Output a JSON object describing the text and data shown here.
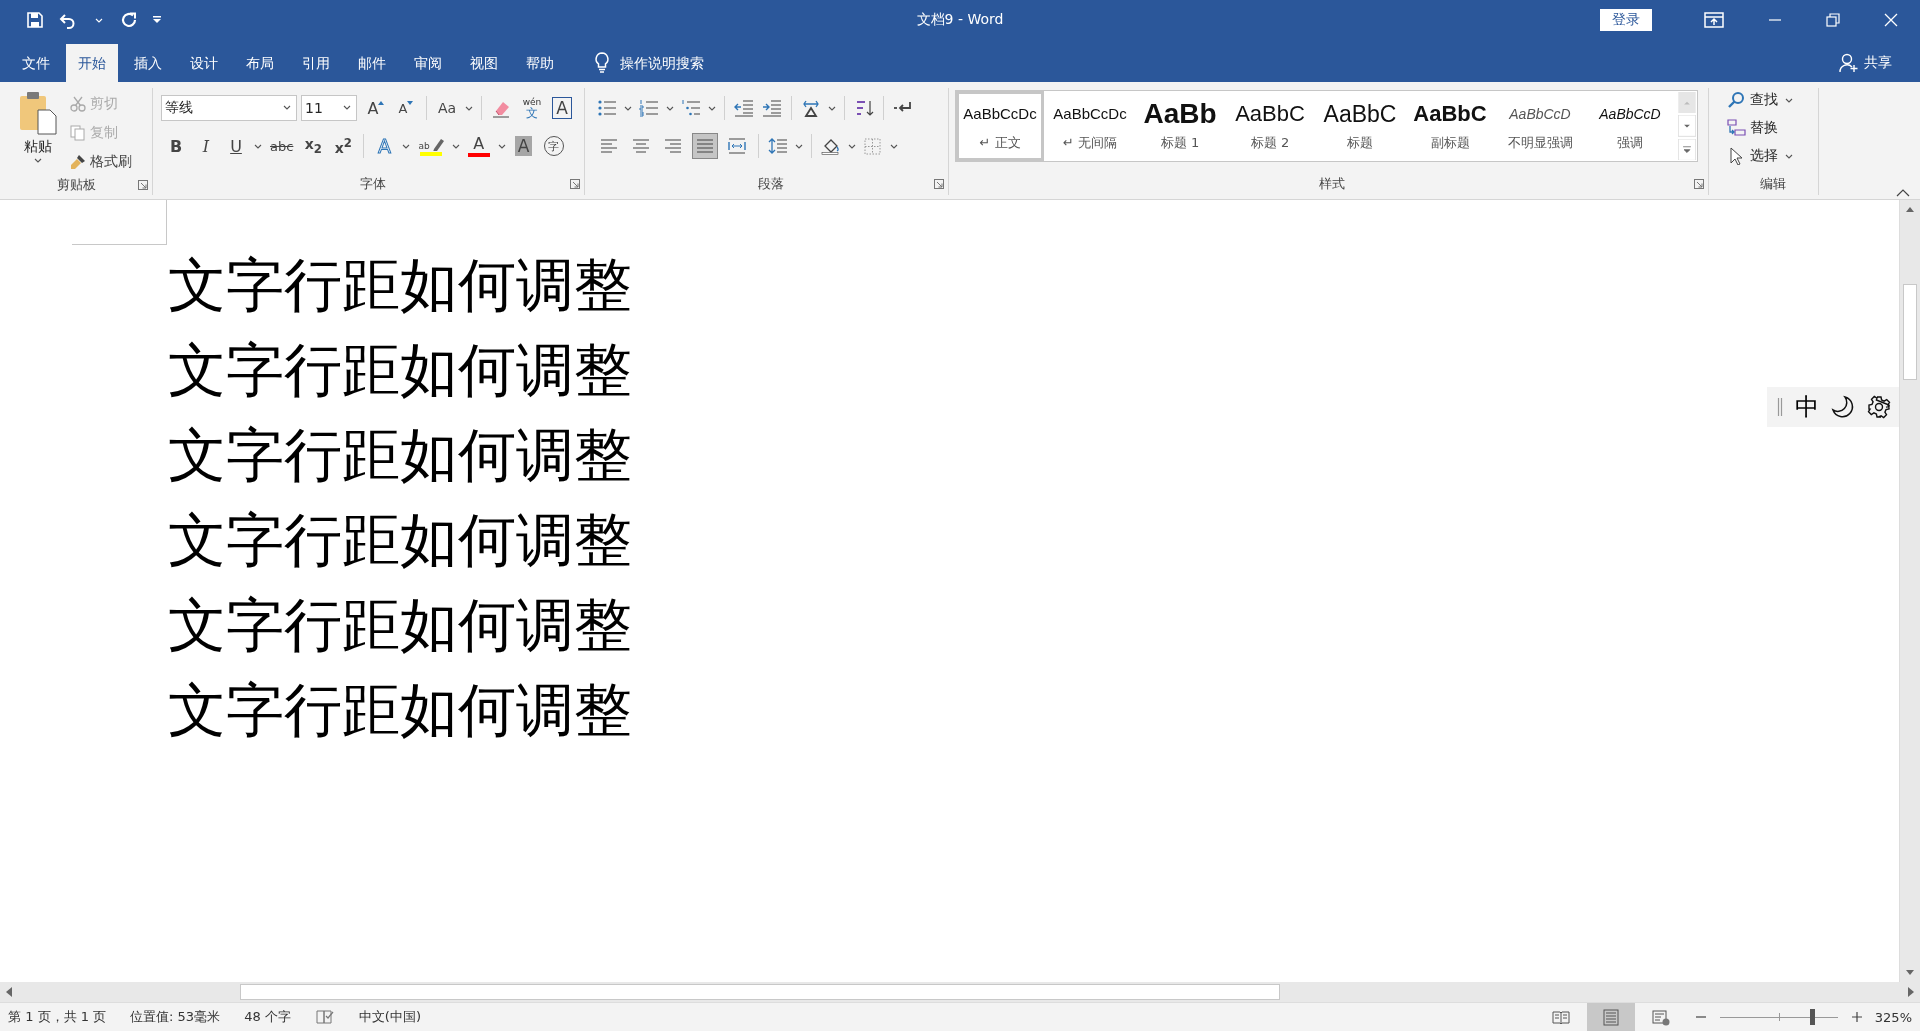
{
  "window": {
    "title": "文档9 - Word"
  },
  "title_bar": {
    "sign_in": "登录"
  },
  "ribbon_tabs": [
    {
      "label": "文件",
      "selected": false
    },
    {
      "label": "开始",
      "selected": true
    },
    {
      "label": "插入",
      "selected": false
    },
    {
      "label": "设计",
      "selected": false
    },
    {
      "label": "布局",
      "selected": false
    },
    {
      "label": "引用",
      "selected": false
    },
    {
      "label": "邮件",
      "selected": false
    },
    {
      "label": "审阅",
      "selected": false
    },
    {
      "label": "视图",
      "selected": false
    },
    {
      "label": "帮助",
      "selected": false
    }
  ],
  "tell_me": {
    "placeholder": "操作说明搜索"
  },
  "share": "共享",
  "clipboard": {
    "label": "剪贴板",
    "paste": "粘贴",
    "tools": [
      {
        "kind": "cut",
        "label": "剪切",
        "disabled": true
      },
      {
        "kind": "copy",
        "label": "复制",
        "disabled": true
      },
      {
        "kind": "painter",
        "label": "格式刷",
        "disabled": false
      }
    ]
  },
  "font": {
    "label": "字体",
    "font_name": "等线",
    "font_size": "11",
    "row1": [
      {
        "kind": "grow",
        "label": "A",
        "dropdown": false
      },
      {
        "kind": "shrink",
        "label": "A",
        "dropdown": false
      },
      {
        "kind": "case",
        "label": "Aa",
        "dropdown": true
      },
      {
        "kind": "clear",
        "dropdown": false
      },
      {
        "kind": "pinyin",
        "label": "文",
        "ruby": "wén",
        "dropdown": false
      },
      {
        "kind": "border",
        "label": "A",
        "dropdown": false
      }
    ],
    "row2": [
      {
        "kind": "bold",
        "label": "B",
        "dropdown": false
      },
      {
        "kind": "italic",
        "label": "I",
        "dropdown": false
      },
      {
        "kind": "underline",
        "label": "U",
        "dropdown": true
      },
      {
        "kind": "strike",
        "label": "abc",
        "dropdown": false
      },
      {
        "kind": "subscript",
        "label": "x$_{2}$",
        "dropdown": false
      },
      {
        "kind": "superscript",
        "label": "x$^{2}$",
        "dropdown": false
      },
      {
        "kind": "effects",
        "label": "A",
        "dropdown": true
      },
      {
        "kind": "highlight",
        "label": "ab",
        "color": "#ffff00",
        "dropdown": true
      },
      {
        "kind": "color",
        "label": "A",
        "color": "#ff0000",
        "dropdown": true
      },
      {
        "kind": "shading",
        "label": "A",
        "dropdown": false
      },
      {
        "kind": "enclose",
        "label": "字",
        "dropdown": false
      }
    ]
  },
  "paragraph": {
    "label": "段落",
    "row1": [
      {
        "kind": "bullets",
        "dropdown": true
      },
      {
        "kind": "numbering",
        "dropdown": true
      },
      {
        "kind": "multilevel",
        "dropdown": true
      },
      {
        "kind": "outdent",
        "dropdown": false
      },
      {
        "kind": "indent",
        "dropdown": false
      },
      {
        "kind": "asian",
        "dropdown": true
      },
      {
        "kind": "sort",
        "dropdown": false
      },
      {
        "kind": "marks",
        "dropdown": false
      }
    ],
    "alignment": [
      {
        "kind": "left",
        "selected": false
      },
      {
        "kind": "center",
        "selected": false
      },
      {
        "kind": "right",
        "selected": false
      },
      {
        "kind": "justify",
        "selected": true
      },
      {
        "kind": "distributed",
        "selected": false
      }
    ],
    "row2": [
      {
        "kind": "spacing",
        "dropdown": true
      },
      {
        "kind": "shading",
        "dropdown": true
      },
      {
        "kind": "borders",
        "dropdown": true
      }
    ]
  },
  "styles": {
    "label": "样式",
    "items": [
      {
        "kind": "normal",
        "sample": "AaBbCcDc",
        "name": "↵ 正文",
        "selected": true
      },
      {
        "kind": "normal",
        "sample": "AaBbCcDc",
        "name": "↵ 无间隔",
        "selected": false
      },
      {
        "kind": "heading1",
        "sample": "AaBb",
        "name": "标题 1",
        "selected": false
      },
      {
        "kind": "heading2",
        "sample": "AaBbC",
        "name": "标题 2",
        "selected": false
      },
      {
        "kind": "title",
        "sample": "AaBbC",
        "name": "标题",
        "selected": false
      },
      {
        "kind": "subtitle",
        "sample": "AaBbC",
        "name": "副标题",
        "selected": false
      },
      {
        "kind": "subtle",
        "sample": "AaBbCcD",
        "name": "不明显强调",
        "selected": false
      },
      {
        "kind": "emphasis",
        "sample": "AaBbCcD",
        "name": "强调",
        "selected": false
      }
    ]
  },
  "editing": {
    "label": "编辑",
    "tools": [
      {
        "kind": "find",
        "label": "查找",
        "dropdown": true
      },
      {
        "kind": "replace",
        "label": "替换",
        "dropdown": false
      },
      {
        "kind": "select",
        "label": "选择",
        "dropdown": true
      }
    ]
  },
  "document": {
    "lines": [
      "文字行距如何调整",
      "文字行距如何调整",
      "文字行距如何调整",
      "文字行距如何调整",
      "文字行距如何调整",
      "文字行距如何调整"
    ]
  },
  "ime_toolbar": {
    "mode": "中"
  },
  "status_bar": {
    "page": "第 1 页，共 1 页",
    "position": "位置值: 53毫米",
    "word_count": "48 个字",
    "language": "中文(中国)",
    "views": [
      {
        "kind": "read",
        "selected": false
      },
      {
        "kind": "print",
        "selected": true
      },
      {
        "kind": "web",
        "selected": false
      }
    ],
    "zoom": {
      "level": 0.77,
      "reading": "325%"
    }
  }
}
